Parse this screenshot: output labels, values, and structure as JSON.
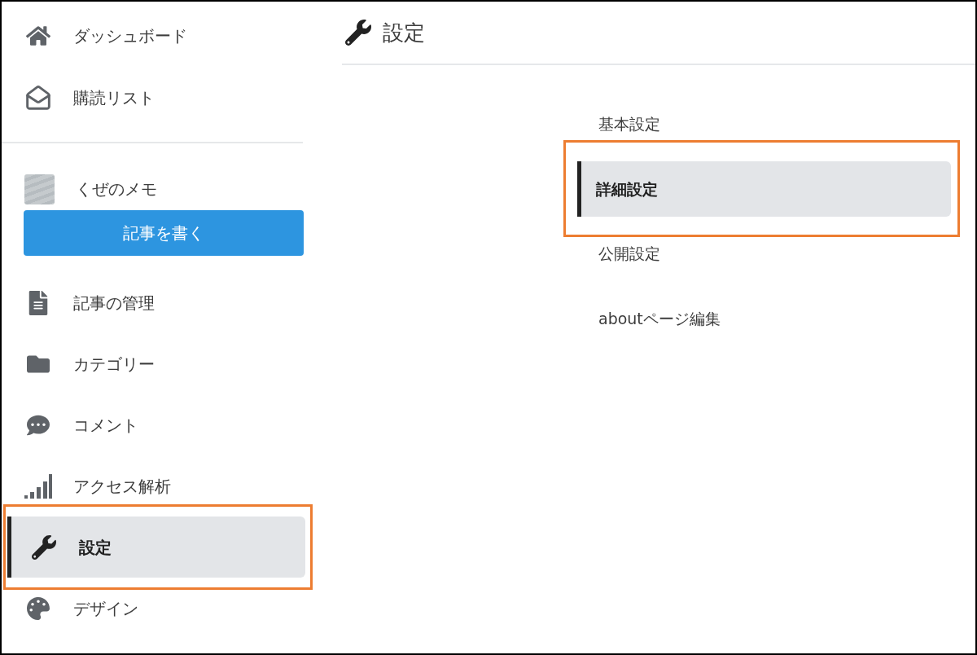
{
  "sidebar": {
    "top_items": [
      {
        "label": "ダッシュボード"
      },
      {
        "label": "購読リスト"
      }
    ],
    "blog": {
      "name": "くぜのメモ"
    },
    "write_button": {
      "label": "記事を書く"
    },
    "items": [
      {
        "label": "記事の管理",
        "selected": false
      },
      {
        "label": "カテゴリー",
        "selected": false
      },
      {
        "label": "コメント",
        "selected": false
      },
      {
        "label": "アクセス解析",
        "selected": false
      },
      {
        "label": "設定",
        "selected": true
      },
      {
        "label": "デザイン",
        "selected": false
      }
    ]
  },
  "main": {
    "title": "設定",
    "menu": [
      {
        "label": "基本設定",
        "selected": false
      },
      {
        "label": "詳細設定",
        "selected": true
      },
      {
        "label": "公開設定",
        "selected": false
      },
      {
        "label": "aboutページ編集",
        "selected": false
      }
    ]
  }
}
